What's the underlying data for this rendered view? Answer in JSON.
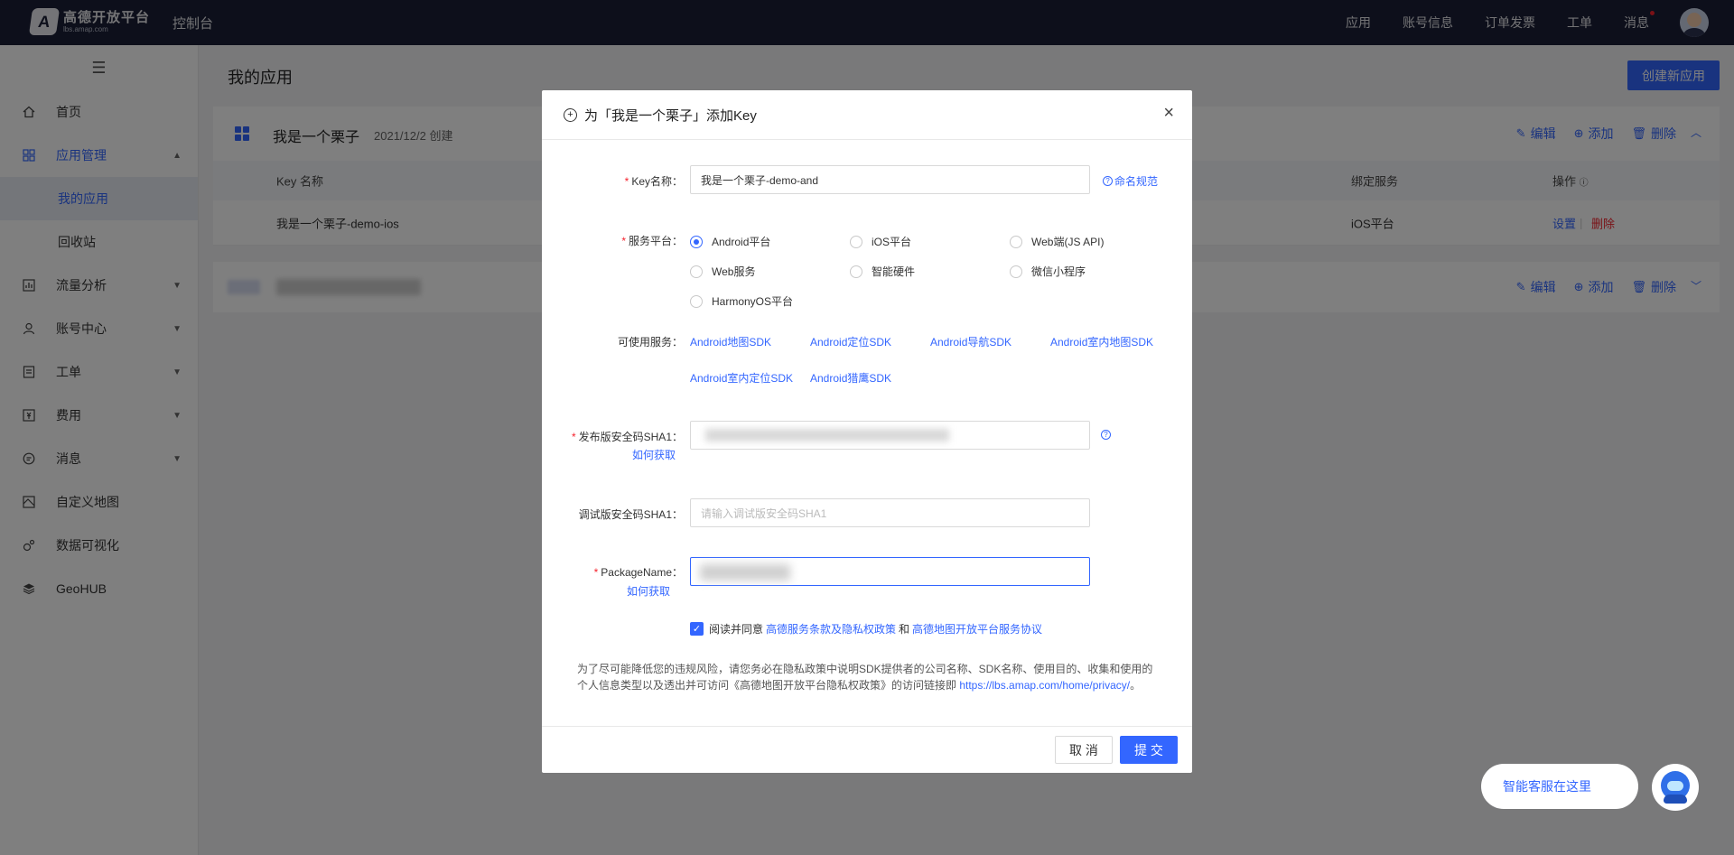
{
  "topbar": {
    "logo_title": "高德开放平台",
    "logo_sub": "lbs.amap.com",
    "console": "控制台",
    "nav": [
      "应用",
      "账号信息",
      "订单发票",
      "工单",
      "消息"
    ]
  },
  "sidebar": {
    "toggle": "☰",
    "items": [
      {
        "label": "首页",
        "icon": "home-icon"
      },
      {
        "label": "应用管理",
        "icon": "apps-icon"
      },
      {
        "label": "流量分析",
        "icon": "chart-icon"
      },
      {
        "label": "账号中心",
        "icon": "user-icon"
      },
      {
        "label": "工单",
        "icon": "ticket-icon"
      },
      {
        "label": "费用",
        "icon": "fee-icon"
      },
      {
        "label": "消息",
        "icon": "message-icon"
      },
      {
        "label": "自定义地图",
        "icon": "map-icon"
      },
      {
        "label": "数据可视化",
        "icon": "visualization-icon"
      },
      {
        "label": "GeoHUB",
        "icon": "layers-icon"
      }
    ],
    "sub_items": [
      "我的应用",
      "回收站"
    ]
  },
  "main": {
    "title": "我的应用",
    "create_button": "创建新应用",
    "app": {
      "name": "我是一个栗子",
      "date": "2021/12/2 创建",
      "actions": {
        "edit": "编辑",
        "add": "添加",
        "delete": "删除"
      },
      "columns": {
        "key_name": "Key 名称",
        "bind_service": "绑定服务",
        "ops": "操作"
      },
      "row": {
        "key_name": "我是一个栗子-demo-ios",
        "service": "iOS平台",
        "settings": "设置",
        "sep": "|",
        "delete": "删除"
      }
    }
  },
  "modal": {
    "title": "为「我是一个栗子」添加Key",
    "close": "×",
    "key_name_label": "Key名称：",
    "key_name_value": "我是一个栗子-demo-and",
    "naming_rule": "命名规范",
    "platform_label": "服务平台：",
    "platforms": [
      "Android平台",
      "iOS平台",
      "Web端(JS API)",
      "Web服务",
      "智能硬件",
      "微信小程序",
      "HarmonyOS平台"
    ],
    "selected_platform": "Android平台",
    "services_label": "可使用服务：",
    "services": [
      "Android地图SDK",
      "Android定位SDK",
      "Android导航SDK",
      "Android室内地图SDK",
      "Android室内定位SDK",
      "Android猎鹰SDK"
    ],
    "release_sha1_label": "发布版安全码SHA1：",
    "how_to_get": "如何获取",
    "debug_sha1_label": "调试版安全码SHA1：",
    "debug_sha1_placeholder": "请输入调试版安全码SHA1",
    "package_label": "PackageName：",
    "agree_prefix": "阅读并同意",
    "agree_link1": "高德服务条款及隐私权政策",
    "agree_and": "和",
    "agree_link2": "高德地图开放平台服务协议",
    "notice_text": "为了尽可能降低您的违规风险，请您务必在隐私政策中说明SDK提供者的公司名称、SDK名称、使用目的、收集和使用的个人信息类型以及透出并可访问《高德地图开放平台隐私权政策》的访问链接即 ",
    "notice_link": "https://lbs.amap.com/home/privacy/",
    "notice_end": "。",
    "cancel": "取 消",
    "submit": "提 交"
  },
  "customer_service": {
    "label": "智能客服在这里"
  },
  "colors": {
    "accent": "#3366ff",
    "topbar": "#1a1f36",
    "danger": "#f5222d"
  }
}
